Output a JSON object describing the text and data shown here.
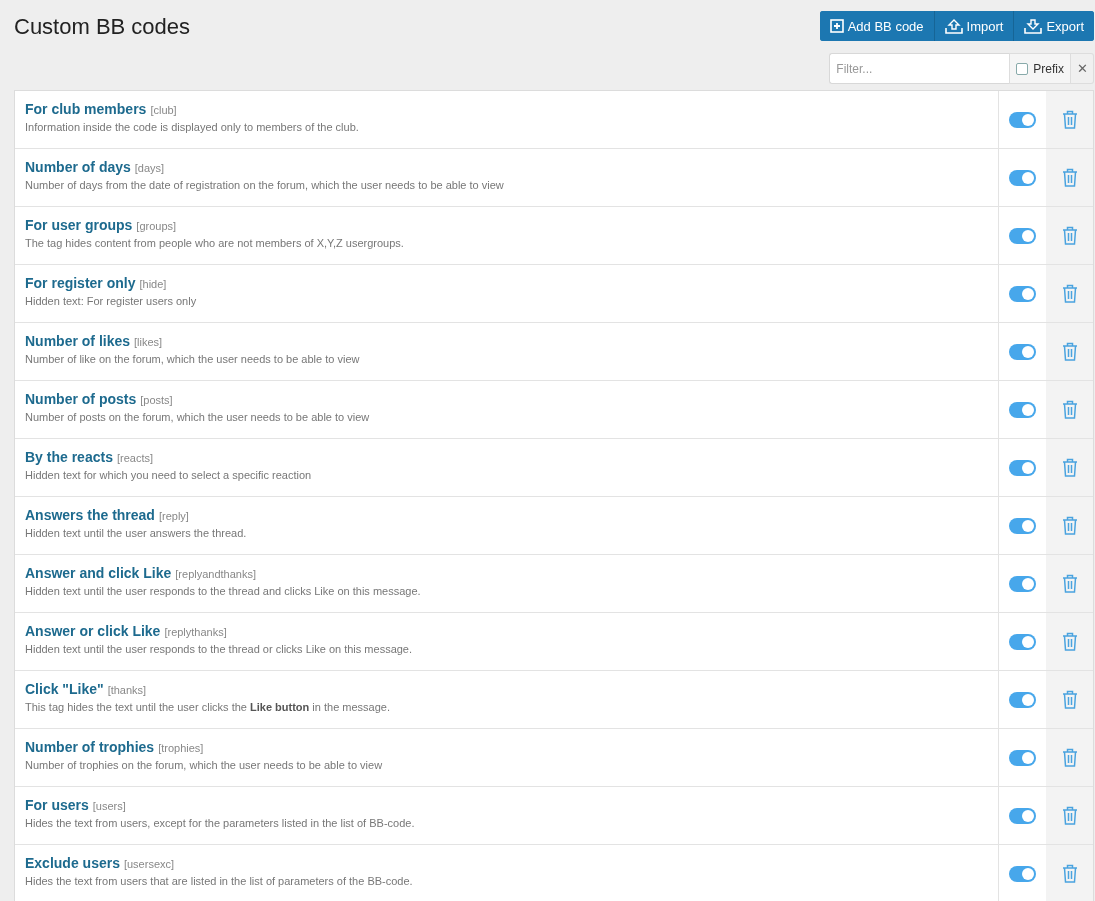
{
  "page": {
    "title": "Custom BB codes"
  },
  "actions": [
    {
      "kind": "add",
      "label": "Add BB code"
    },
    {
      "kind": "import",
      "label": "Import"
    },
    {
      "kind": "export",
      "label": "Export"
    }
  ],
  "filter": {
    "placeholder": "Filter...",
    "prefix_label": "Prefix",
    "prefix_checked": false,
    "clear": "✕"
  },
  "codes": [
    {
      "title": "For club members",
      "tag": "[club]",
      "description": "Information inside the code is displayed only to members of the club.",
      "on": true
    },
    {
      "title": "Number of days",
      "tag": "[days]",
      "description": "Number of days from the date of registration on the forum, which the user needs to be able to view",
      "on": true
    },
    {
      "title": "For user groups",
      "tag": "[groups]",
      "description": "The tag hides content from people who are not members of X,Y,Z usergroups.",
      "on": true
    },
    {
      "title": "For register only",
      "tag": "[hide]",
      "description": "Hidden text: For register users only",
      "on": true
    },
    {
      "title": "Number of likes",
      "tag": "[likes]",
      "description": "Number of like on the forum, which the user needs to be able to view",
      "on": true
    },
    {
      "title": "Number of posts",
      "tag": "[posts]",
      "description": "Number of posts on the forum, which the user needs to be able to view",
      "on": true
    },
    {
      "title": "By the reacts",
      "tag": "[reacts]",
      "description": "Hidden text for which you need to select a specific reaction",
      "on": true
    },
    {
      "title": "Answers the thread",
      "tag": "[reply]",
      "description": "Hidden text until the user answers the thread.",
      "on": true
    },
    {
      "title": "Answer and click Like",
      "tag": "[replyandthanks]",
      "description": "Hidden text until the user responds to the thread and clicks Like on this message.",
      "on": true
    },
    {
      "title": "Answer or click Like",
      "tag": "[replythanks]",
      "description": "Hidden text until the user responds to the thread or clicks Like on this message.",
      "on": true
    },
    {
      "title": "Click \"Like\"",
      "tag": "[thanks]",
      "description": "This tag hides the text until the user clicks the **Like button** in the message.",
      "on": true
    },
    {
      "title": "Number of trophies",
      "tag": "[trophies]",
      "description": "Number of trophies on the forum, which the user needs to be able to view",
      "on": true
    },
    {
      "title": "For users",
      "tag": "[users]",
      "description": "Hides the text from users, except for the parameters listed in the list of BB-code.",
      "on": true
    },
    {
      "title": "Exclude users",
      "tag": "[usersexc]",
      "description": "Hides the text from users that are listed in the list of parameters of the BB-code.",
      "on": true
    }
  ]
}
